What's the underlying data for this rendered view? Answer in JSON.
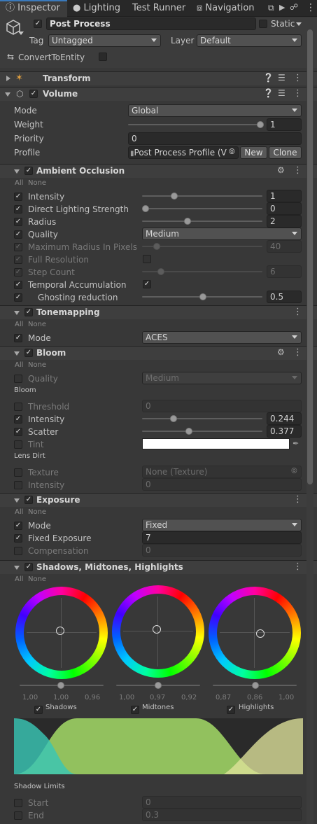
{
  "tabs": {
    "inspector": "Inspector",
    "lighting": "Lighting",
    "test_runner": "Test Runner",
    "navigation": "Navigation"
  },
  "object": {
    "name": "Post Process",
    "static_label": "Static",
    "tag_label": "Tag",
    "tag_value": "Untagged",
    "layer_label": "Layer",
    "layer_value": "Default",
    "convert_label": "ConvertToEntity"
  },
  "transform": {
    "title": "Transform"
  },
  "volume": {
    "title": "Volume",
    "mode_label": "Mode",
    "mode_value": "Global",
    "weight_label": "Weight",
    "weight_value": "1",
    "weight_level": 1.0,
    "priority_label": "Priority",
    "priority_value": "0",
    "profile_label": "Profile",
    "profile_value": "Post Process Profile (V",
    "new_button": "New",
    "clone_button": "Clone"
  },
  "toggles": {
    "all": "All",
    "none": "None"
  },
  "ao": {
    "title": "Ambient Occlusion",
    "intensity_label": "Intensity",
    "intensity_value": "1",
    "direct_label": "Direct Lighting Strength",
    "direct_value": "0",
    "radius_label": "Radius",
    "radius_value": "2",
    "quality_label": "Quality",
    "quality_value": "Medium",
    "maxradius_label": "Maximum Radius In Pixels",
    "maxradius_value": "40",
    "fullres_label": "Full Resolution",
    "stepcount_label": "Step Count",
    "stepcount_value": "6",
    "temporal_label": "Temporal Accumulation",
    "ghosting_label": "Ghosting reduction",
    "ghosting_value": "0.5"
  },
  "tonemapping": {
    "title": "Tonemapping",
    "mode_label": "Mode",
    "mode_value": "ACES"
  },
  "bloom": {
    "title": "Bloom",
    "quality_label": "Quality",
    "quality_value": "Medium",
    "subheader": "Bloom",
    "threshold_label": "Threshold",
    "threshold_value": "0",
    "intensity_label": "Intensity",
    "intensity_value": "0.244",
    "scatter_label": "Scatter",
    "scatter_value": "0.377",
    "tint_label": "Tint",
    "lensdirt_header": "Lens Dirt",
    "texture_label": "Texture",
    "texture_value": "None (Texture)",
    "dirt_intensity_label": "Intensity",
    "dirt_intensity_value": "0"
  },
  "exposure": {
    "title": "Exposure",
    "mode_label": "Mode",
    "mode_value": "Fixed",
    "fixed_label": "Fixed Exposure",
    "fixed_value": "7",
    "comp_label": "Compensation",
    "comp_value": "0"
  },
  "smh": {
    "title": "Shadows, Midtones, Highlights",
    "wheels": [
      {
        "name": "Shadows",
        "values": [
          "1,00",
          "1,00",
          "0,96"
        ]
      },
      {
        "name": "Midtones",
        "values": [
          "1,00",
          "0,97",
          "0,92"
        ]
      },
      {
        "name": "Highlights",
        "values": [
          "0,87",
          "0,86",
          "1,00"
        ]
      }
    ],
    "limits_header": "Shadow Limits",
    "start_label": "Start",
    "start_value": "0",
    "end_label": "End",
    "end_value": "0.3"
  },
  "colors": {
    "shadow_curve": "#39c6b5",
    "midtone_curve": "#a9e36a",
    "highlight_curve": "#dfe39b"
  }
}
